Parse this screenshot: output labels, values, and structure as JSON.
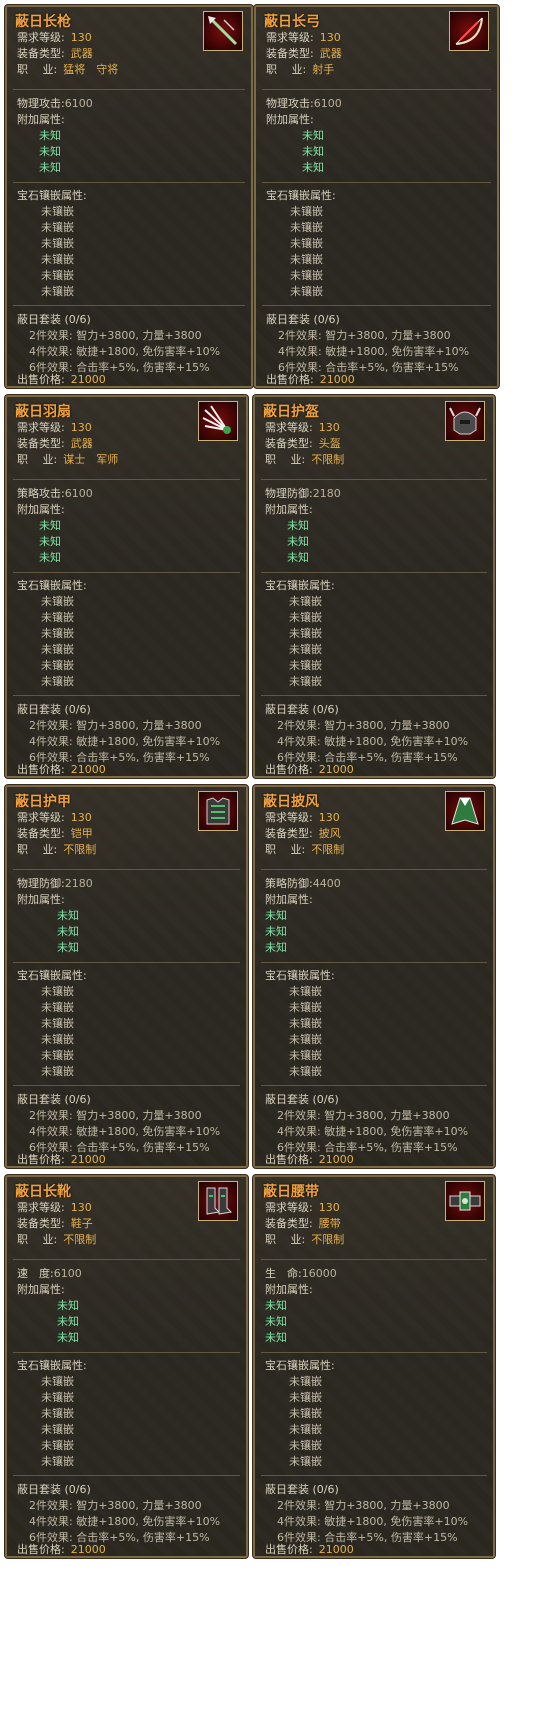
{
  "labels": {
    "req_level": "需求等级:",
    "equip_type": "装备类型:",
    "job": "职　 业:",
    "extra": "附加属性:",
    "gem": "宝石镶嵌属性:",
    "price": "出售价格:"
  },
  "common": {
    "level": "130",
    "unknown": "未知",
    "unset": "未镶嵌",
    "set_name": "蔽日套装 (0/6)",
    "set_2_label": "2件效果:",
    "set_2": "智力+3800, 力量+3800",
    "set_4_label": "4件效果:",
    "set_4": "敏捷+1800, 免伤害率+10%",
    "set_6_label": "6件效果:",
    "set_6": "合击率+5%, 伤害率+15%",
    "price": "21000"
  },
  "cards": [
    {
      "name": "蔽日长枪",
      "type": "武器",
      "job": "猛将　守将",
      "stat_label": "物理攻击:",
      "stat_value": "6100",
      "icon": "spear-icon"
    },
    {
      "name": "蔽日长弓",
      "type": "武器",
      "job": "射手",
      "stat_label": "物理攻击:",
      "stat_value": "6100",
      "icon": "bow-icon"
    },
    {
      "name": "蔽日羽扇",
      "type": "武器",
      "job": "谋士　军师",
      "stat_label": "策略攻击:",
      "stat_value": "6100",
      "icon": "fan-icon"
    },
    {
      "name": "蔽日护盔",
      "type": "头盔",
      "job": "不限制",
      "stat_label": "物理防御:",
      "stat_value": "2180",
      "icon": "helmet-icon"
    },
    {
      "name": "蔽日护甲",
      "type": "铠甲",
      "job": "不限制",
      "stat_label": "物理防御:",
      "stat_value": "2180",
      "icon": "armor-icon"
    },
    {
      "name": "蔽日披风",
      "type": "披风",
      "job": "不限制",
      "stat_label": "策略防御:",
      "stat_value": "4400",
      "icon": "cloak-icon"
    },
    {
      "name": "蔽日长靴",
      "type": "鞋子",
      "job": "不限制",
      "stat_label": "速　度:",
      "stat_value": "6100",
      "icon": "boots-icon"
    },
    {
      "name": "蔽日腰带",
      "type": "腰带",
      "job": "不限制",
      "stat_label": "生　命:",
      "stat_value": "16000",
      "icon": "belt-icon"
    }
  ]
}
